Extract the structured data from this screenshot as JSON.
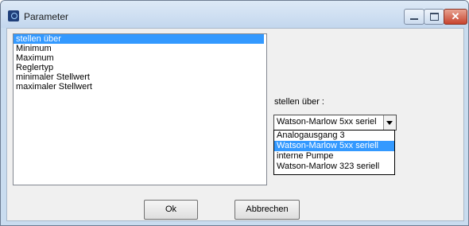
{
  "window": {
    "title": "Parameter"
  },
  "list": {
    "items": [
      "stellen über",
      "Minimum",
      "Maximum",
      "Reglertyp",
      "minimaler Stellwert",
      "maximaler Stellwert"
    ],
    "selected": "stellen über"
  },
  "field": {
    "label": "stellen über :"
  },
  "combo": {
    "value": "Watson-Marlow 5xx seriel",
    "options": [
      "Analogausgang 3",
      "Watson-Marlow 5xx seriell",
      "interne Pumpe",
      "Watson-Marlow 323 seriell"
    ],
    "highlighted": "Watson-Marlow 5xx seriell"
  },
  "buttons": {
    "ok": "Ok",
    "cancel": "Abbrechen"
  },
  "colors": {
    "selection": "#3399ff",
    "close": "#c7432e"
  }
}
